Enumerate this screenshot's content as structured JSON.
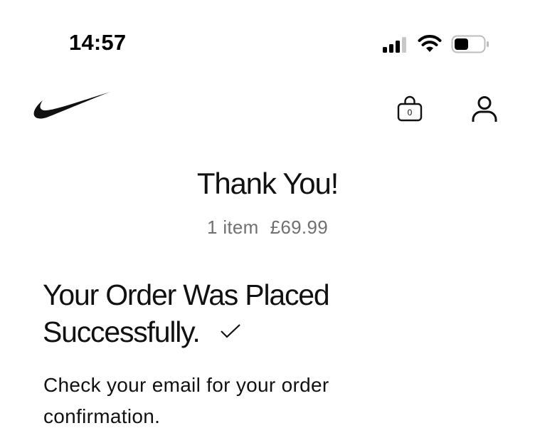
{
  "status_bar": {
    "time": "14:57",
    "icons": [
      "cellular-signal-icon",
      "wifi-icon",
      "battery-icon"
    ]
  },
  "header": {
    "logo": "nike-swoosh-logo",
    "bag_count": "0",
    "icons": [
      "shopping-bag-icon",
      "profile-icon"
    ]
  },
  "confirmation": {
    "title": "Thank You!",
    "item_count": "1 item",
    "total": "£69.99",
    "heading_line1": "Your Order Was Placed",
    "heading_line2": "Successfully.",
    "heading_icon": "checkmark-icon",
    "message": "Check your email for your order confirmation."
  },
  "colors": {
    "text": "#111111",
    "muted": "#707072",
    "background": "#ffffff"
  }
}
